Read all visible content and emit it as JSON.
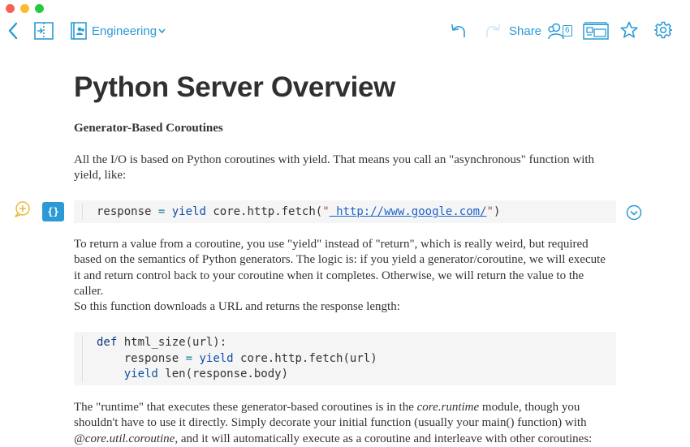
{
  "colors": {
    "accent": "#2c9ad6",
    "title": "#303030",
    "text": "#333333",
    "code_bg": "#f5f5f5",
    "comment_icon": "#e8b93a"
  },
  "toolbar": {
    "folder_label": "Engineering",
    "share_label": "Share",
    "user_count": "6",
    "icons": [
      "chevron-left-icon",
      "sidebar-toggle-icon",
      "folder-people-icon",
      "chevron-down-icon",
      "undo-icon",
      "redo-icon",
      "users-icon",
      "present-icon",
      "star-icon",
      "gear-icon"
    ]
  },
  "document": {
    "title": "Python Server Overview",
    "section_heading": "Generator-Based Coroutines",
    "p1": "All the I/O is based on Python coroutines with yield. That means you call an \"asynchronous\" function with yield, like:",
    "code1": {
      "badge": "{}",
      "line": {
        "var": "response",
        "eq": "=",
        "kw": "yield",
        "call": "core.http.fetch(",
        "q1": "\"",
        "url": " http://www.google.com/",
        "q2": "\"",
        "close": ")"
      }
    },
    "p2_lines": [
      "To return a value from a coroutine, you use \"yield\" instead of \"return\", which is really weird, but required",
      "based on the semantics of Python generators. The logic is: if you yield a generator/coroutine, we will execute",
      "it and return control back to your coroutine when it completes. Otherwise, we will return the value to the",
      "caller.",
      "So this function downloads a URL and returns the response length:"
    ],
    "code2": {
      "l1_kw": "def",
      "l1_rest": " html_size(url):",
      "l2_var": "    response",
      "l2_eq": "=",
      "l2_kw": "yield",
      "l2_rest": " core.http.fetch(url)",
      "l3_kw": "    yield",
      "l3_rest": " len(response.body)"
    },
    "p4": {
      "a": "The \"runtime\" that executes these generator-based coroutines is in the ",
      "b": "core.runtime",
      "c": " module, though you shouldn't have to use it directly. Simply decorate your initial function (usually your main() function) with ",
      "d": "@core.util.coroutine",
      "e": ", and it will automatically execute as a coroutine and interleave with other coroutines:"
    }
  }
}
